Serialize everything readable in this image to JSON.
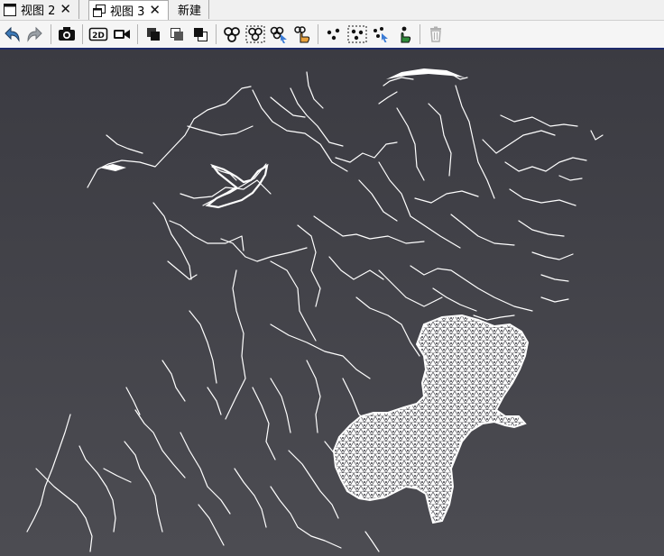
{
  "tabs": [
    {
      "label": "视图 2",
      "icon": "window-icon",
      "active": false,
      "closable": true
    },
    {
      "label": "视图 3",
      "icon": "restore-window-icon",
      "active": true,
      "closable": true
    },
    {
      "label": "新建",
      "icon": "",
      "active": false,
      "closable": false
    }
  ],
  "toolbar": {
    "groups": [
      [
        "undo-icon",
        "redo-icon"
      ],
      [
        "camera-icon"
      ],
      [
        "2d-icon",
        "video-icon"
      ],
      [
        "layer-front-icon",
        "layer-overlap-icon",
        "layer-back-icon"
      ],
      [
        "circles-select-icon",
        "circles-box-select-icon",
        "circles-pointer-icon",
        "circles-hand-icon"
      ],
      [
        "points-select-icon",
        "points-box-select-icon",
        "points-pointer-icon",
        "points-hand-icon"
      ],
      [
        "trash-icon"
      ]
    ],
    "badge_2d": "2D"
  },
  "viewport": {
    "background_top": "#3b3b42",
    "background_bottom": "#4c4c52",
    "line_color": "#ffffff",
    "content": "river network map with meshed region"
  }
}
